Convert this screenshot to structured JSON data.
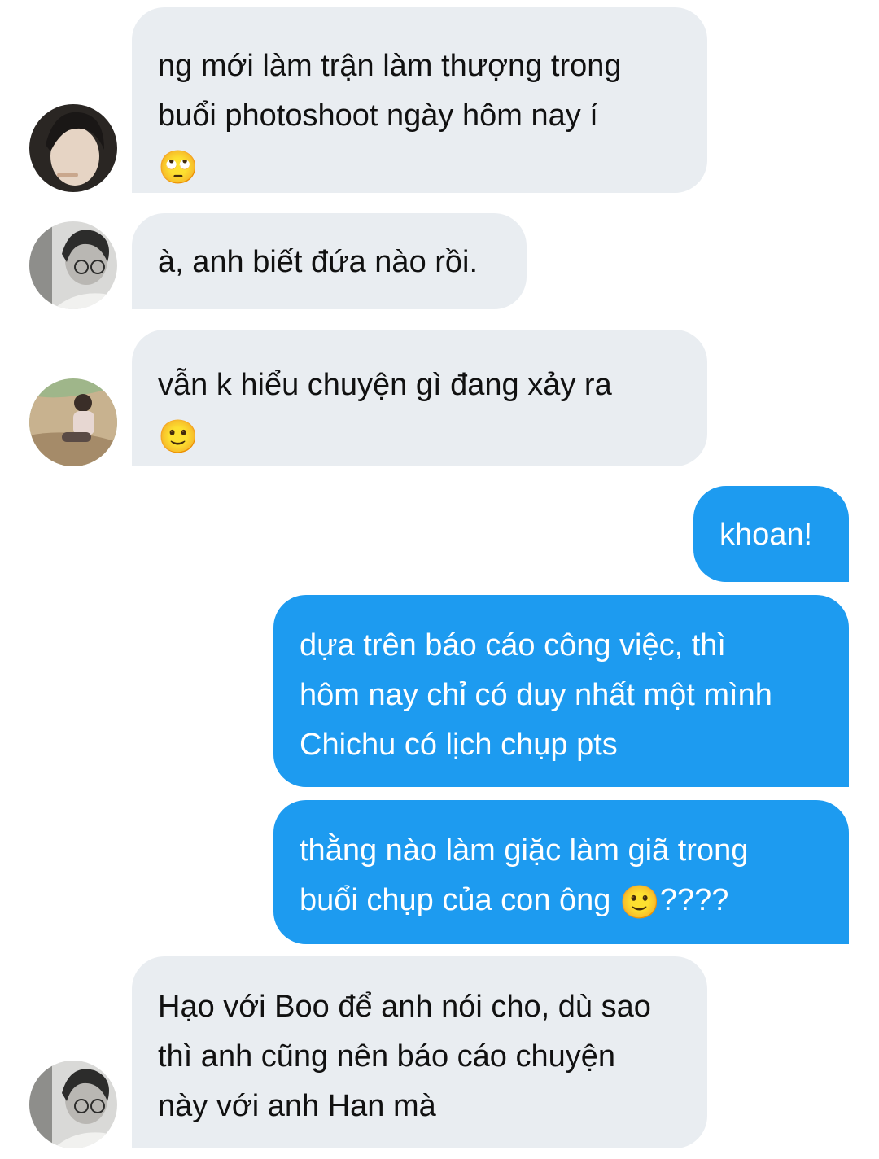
{
  "messages": [
    {
      "side": "in",
      "text": "ng mới làm trận làm thượng trong\nbuổi photoshoot ngày hôm nay í",
      "emoji": "🙄",
      "tail": "",
      "avatar": "avatar-1"
    },
    {
      "side": "in",
      "text": "à, anh biết đứa nào rồi.",
      "emoji": "",
      "tail": "",
      "avatar": "avatar-2"
    },
    {
      "side": "in",
      "text": "vẫn k hiểu chuyện gì đang xảy ra",
      "emoji": "🙂",
      "tail": "",
      "avatar": "avatar-3"
    },
    {
      "side": "out",
      "text": "khoan!",
      "emoji": "",
      "tail": ""
    },
    {
      "side": "out",
      "text": "dựa trên báo cáo công việc, thì\nhôm nay chỉ có duy nhất một mình\nChichu có lịch chụp pts",
      "emoji": "",
      "tail": ""
    },
    {
      "side": "out",
      "text": "thằng nào làm giặc làm giã trong\nbuổi chụp của con ông ",
      "emoji": "🙂",
      "tail": "????"
    },
    {
      "side": "in",
      "text": "Hạo với Boo để anh nói cho, dù sao\nthì anh cũng nên báo cáo chuyện\nnày với anh Han mà",
      "emoji": "",
      "tail": "",
      "avatar": "avatar-2"
    }
  ],
  "colors": {
    "incoming_bubble": "#e9edf1",
    "outgoing_bubble": "#1d9bf0"
  }
}
